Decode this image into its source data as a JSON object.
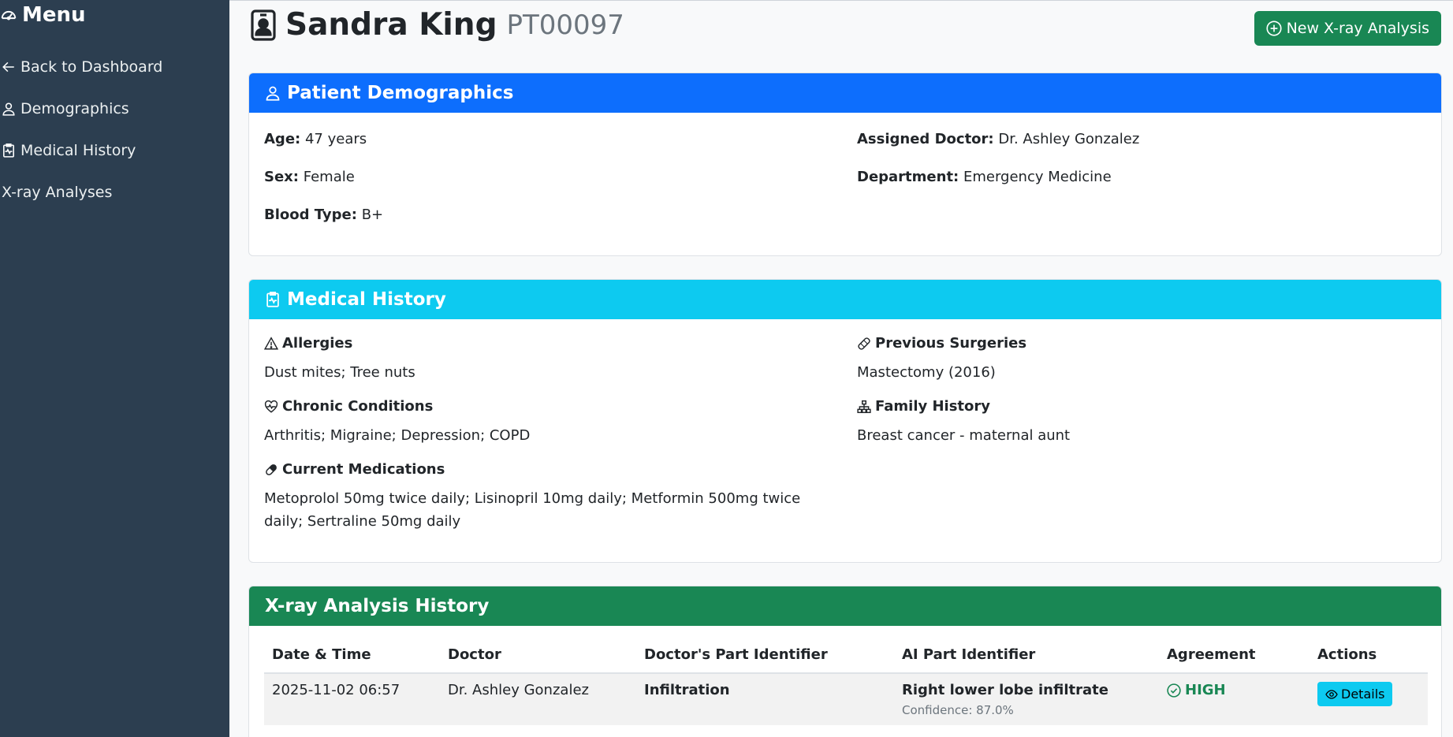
{
  "sidebar": {
    "title": "Menu",
    "items": [
      {
        "label": "Back to Dashboard"
      },
      {
        "label": "Demographics"
      },
      {
        "label": "Medical History"
      },
      {
        "label": "X-ray Analyses"
      }
    ]
  },
  "header": {
    "name": "Sandra King",
    "patient_id": "PT00097",
    "new_button": "New X-ray Analysis"
  },
  "demographics": {
    "title": "Patient Demographics",
    "age_label": "Age:",
    "age": "47 years",
    "sex_label": "Sex:",
    "sex": "Female",
    "blood_label": "Blood Type:",
    "blood": "B+",
    "doctor_label": "Assigned Doctor:",
    "doctor": "Dr. Ashley Gonzalez",
    "dept_label": "Department:",
    "dept": "Emergency Medicine"
  },
  "history": {
    "title": "Medical History",
    "allergies_label": "Allergies",
    "allergies": "Dust mites; Tree nuts",
    "chronic_label": "Chronic Conditions",
    "chronic": "Arthritis; Migraine; Depression; COPD",
    "meds_label": "Current Medications",
    "meds": "Metoprolol 50mg twice daily; Lisinopril 10mg daily; Metformin 500mg twice daily; Sertraline 50mg daily",
    "surgeries_label": "Previous Surgeries",
    "surgeries": "Mastectomy (2016)",
    "family_label": "Family History",
    "family": "Breast cancer - maternal aunt"
  },
  "xray": {
    "title": "X-ray Analysis History",
    "columns": [
      "Date & Time",
      "Doctor",
      "Doctor's Part Identifier",
      "AI Part Identifier",
      "Agreement",
      "Actions"
    ],
    "rows": [
      {
        "datetime": "2025-11-02 06:57",
        "doctor": "Dr. Ashley Gonzalez",
        "doctor_part": "Infiltration",
        "ai_part": "Right lower lobe infiltrate",
        "confidence": "Confidence: 87.0%",
        "agreement": "HIGH",
        "action": "Details"
      }
    ]
  },
  "colors": {
    "sidebar": "#2c3e50",
    "primary": "#0d6efd",
    "info": "#0dcaf0",
    "success": "#198754"
  }
}
